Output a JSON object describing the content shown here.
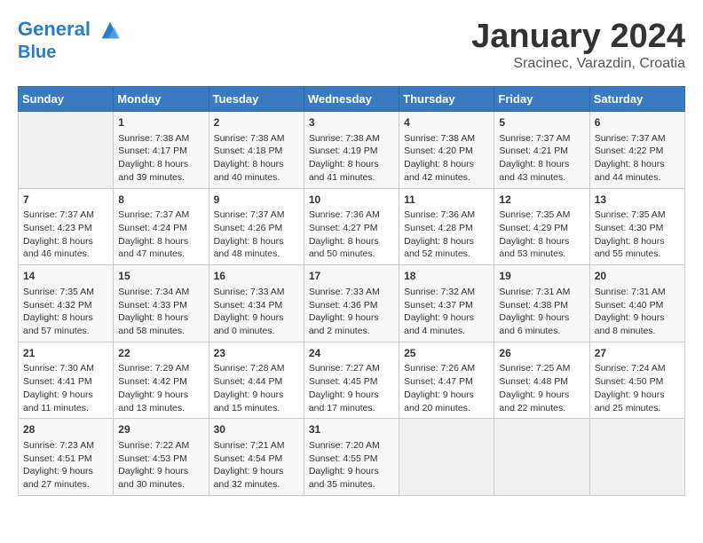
{
  "header": {
    "logo_line1": "General",
    "logo_line2": "Blue",
    "title": "January 2024",
    "location": "Sracinec, Varazdin, Croatia"
  },
  "weekdays": [
    "Sunday",
    "Monday",
    "Tuesday",
    "Wednesday",
    "Thursday",
    "Friday",
    "Saturday"
  ],
  "weeks": [
    [
      {
        "day": "",
        "info": ""
      },
      {
        "day": "1",
        "info": "Sunrise: 7:38 AM\nSunset: 4:17 PM\nDaylight: 8 hours\nand 39 minutes."
      },
      {
        "day": "2",
        "info": "Sunrise: 7:38 AM\nSunset: 4:18 PM\nDaylight: 8 hours\nand 40 minutes."
      },
      {
        "day": "3",
        "info": "Sunrise: 7:38 AM\nSunset: 4:19 PM\nDaylight: 8 hours\nand 41 minutes."
      },
      {
        "day": "4",
        "info": "Sunrise: 7:38 AM\nSunset: 4:20 PM\nDaylight: 8 hours\nand 42 minutes."
      },
      {
        "day": "5",
        "info": "Sunrise: 7:37 AM\nSunset: 4:21 PM\nDaylight: 8 hours\nand 43 minutes."
      },
      {
        "day": "6",
        "info": "Sunrise: 7:37 AM\nSunset: 4:22 PM\nDaylight: 8 hours\nand 44 minutes."
      }
    ],
    [
      {
        "day": "7",
        "info": "Sunrise: 7:37 AM\nSunset: 4:23 PM\nDaylight: 8 hours\nand 46 minutes."
      },
      {
        "day": "8",
        "info": "Sunrise: 7:37 AM\nSunset: 4:24 PM\nDaylight: 8 hours\nand 47 minutes."
      },
      {
        "day": "9",
        "info": "Sunrise: 7:37 AM\nSunset: 4:26 PM\nDaylight: 8 hours\nand 48 minutes."
      },
      {
        "day": "10",
        "info": "Sunrise: 7:36 AM\nSunset: 4:27 PM\nDaylight: 8 hours\nand 50 minutes."
      },
      {
        "day": "11",
        "info": "Sunrise: 7:36 AM\nSunset: 4:28 PM\nDaylight: 8 hours\nand 52 minutes."
      },
      {
        "day": "12",
        "info": "Sunrise: 7:35 AM\nSunset: 4:29 PM\nDaylight: 8 hours\nand 53 minutes."
      },
      {
        "day": "13",
        "info": "Sunrise: 7:35 AM\nSunset: 4:30 PM\nDaylight: 8 hours\nand 55 minutes."
      }
    ],
    [
      {
        "day": "14",
        "info": "Sunrise: 7:35 AM\nSunset: 4:32 PM\nDaylight: 8 hours\nand 57 minutes."
      },
      {
        "day": "15",
        "info": "Sunrise: 7:34 AM\nSunset: 4:33 PM\nDaylight: 8 hours\nand 58 minutes."
      },
      {
        "day": "16",
        "info": "Sunrise: 7:33 AM\nSunset: 4:34 PM\nDaylight: 9 hours\nand 0 minutes."
      },
      {
        "day": "17",
        "info": "Sunrise: 7:33 AM\nSunset: 4:36 PM\nDaylight: 9 hours\nand 2 minutes."
      },
      {
        "day": "18",
        "info": "Sunrise: 7:32 AM\nSunset: 4:37 PM\nDaylight: 9 hours\nand 4 minutes."
      },
      {
        "day": "19",
        "info": "Sunrise: 7:31 AM\nSunset: 4:38 PM\nDaylight: 9 hours\nand 6 minutes."
      },
      {
        "day": "20",
        "info": "Sunrise: 7:31 AM\nSunset: 4:40 PM\nDaylight: 9 hours\nand 8 minutes."
      }
    ],
    [
      {
        "day": "21",
        "info": "Sunrise: 7:30 AM\nSunset: 4:41 PM\nDaylight: 9 hours\nand 11 minutes."
      },
      {
        "day": "22",
        "info": "Sunrise: 7:29 AM\nSunset: 4:42 PM\nDaylight: 9 hours\nand 13 minutes."
      },
      {
        "day": "23",
        "info": "Sunrise: 7:28 AM\nSunset: 4:44 PM\nDaylight: 9 hours\nand 15 minutes."
      },
      {
        "day": "24",
        "info": "Sunrise: 7:27 AM\nSunset: 4:45 PM\nDaylight: 9 hours\nand 17 minutes."
      },
      {
        "day": "25",
        "info": "Sunrise: 7:26 AM\nSunset: 4:47 PM\nDaylight: 9 hours\nand 20 minutes."
      },
      {
        "day": "26",
        "info": "Sunrise: 7:25 AM\nSunset: 4:48 PM\nDaylight: 9 hours\nand 22 minutes."
      },
      {
        "day": "27",
        "info": "Sunrise: 7:24 AM\nSunset: 4:50 PM\nDaylight: 9 hours\nand 25 minutes."
      }
    ],
    [
      {
        "day": "28",
        "info": "Sunrise: 7:23 AM\nSunset: 4:51 PM\nDaylight: 9 hours\nand 27 minutes."
      },
      {
        "day": "29",
        "info": "Sunrise: 7:22 AM\nSunset: 4:53 PM\nDaylight: 9 hours\nand 30 minutes."
      },
      {
        "day": "30",
        "info": "Sunrise: 7:21 AM\nSunset: 4:54 PM\nDaylight: 9 hours\nand 32 minutes."
      },
      {
        "day": "31",
        "info": "Sunrise: 7:20 AM\nSunset: 4:55 PM\nDaylight: 9 hours\nand 35 minutes."
      },
      {
        "day": "",
        "info": ""
      },
      {
        "day": "",
        "info": ""
      },
      {
        "day": "",
        "info": ""
      }
    ]
  ]
}
